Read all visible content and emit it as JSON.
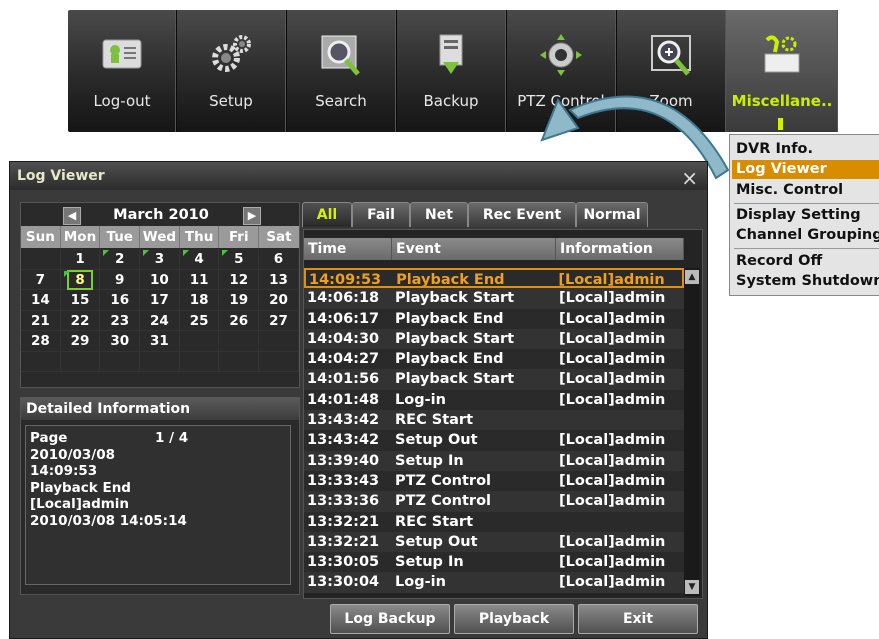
{
  "toolbar": {
    "items": [
      {
        "label": "Log-out",
        "icon": "logout-icon"
      },
      {
        "label": "Setup",
        "icon": "gears-icon"
      },
      {
        "label": "Search",
        "icon": "search-icon"
      },
      {
        "label": "Backup",
        "icon": "backup-icon"
      },
      {
        "label": "PTZ Control",
        "icon": "ptz-icon"
      },
      {
        "label": "Zoom",
        "icon": "zoom-icon"
      },
      {
        "label": "Miscellane..",
        "icon": "misc-icon"
      }
    ],
    "active_color": "#c8f000"
  },
  "menu": {
    "items": [
      "DVR Info.",
      "Log Viewer",
      "Misc. Control",
      "Display Setting",
      "Channel Grouping",
      "Record Off",
      "System Shutdown"
    ],
    "highlighted": "Log Viewer",
    "highlight_color": "#d88c00"
  },
  "window": {
    "title": "Log Viewer",
    "close": "×"
  },
  "calendar": {
    "month": "March 2010",
    "prev": "◀",
    "next": "▶",
    "days": [
      "Sun",
      "Mon",
      "Tue",
      "Wed",
      "Thu",
      "Fri",
      "Sat"
    ],
    "weeks": [
      [
        "",
        "1",
        "2",
        "3",
        "4",
        "5",
        "6"
      ],
      [
        "7",
        "8",
        "9",
        "10",
        "11",
        "12",
        "13"
      ],
      [
        "14",
        "15",
        "16",
        "17",
        "18",
        "19",
        "20"
      ],
      [
        "21",
        "22",
        "23",
        "24",
        "25",
        "26",
        "27"
      ],
      [
        "28",
        "29",
        "30",
        "31",
        "",
        "",
        ""
      ],
      [
        "",
        "",
        "",
        "",
        "",
        "",
        ""
      ]
    ],
    "selected": "8",
    "recorded_days": [
      "2",
      "3",
      "4",
      "5",
      "8"
    ]
  },
  "detail": {
    "title": "Detailed Information",
    "page_label": "Page",
    "page_value": "1 / 4",
    "date": "2010/03/08",
    "time": "14:09:53",
    "event": "Playback End",
    "user": "[Local]admin",
    "timestamp": "2010/03/08 14:05:14"
  },
  "tabs": [
    "All",
    "Fail",
    "Net",
    "Rec Event",
    "Normal"
  ],
  "active_tab": "All",
  "log": {
    "columns": [
      "Time",
      "Event",
      "Information"
    ],
    "rows": [
      [
        "14:09:53",
        "Playback End",
        "[Local]admin"
      ],
      [
        "14:06:18",
        "Playback Start",
        "[Local]admin"
      ],
      [
        "14:06:17",
        "Playback End",
        "[Local]admin"
      ],
      [
        "14:04:30",
        "Playback Start",
        "[Local]admin"
      ],
      [
        "14:04:27",
        "Playback End",
        "[Local]admin"
      ],
      [
        "14:01:56",
        "Playback Start",
        "[Local]admin"
      ],
      [
        "14:01:48",
        "Log-in",
        "[Local]admin"
      ],
      [
        "13:43:42",
        "REC Start",
        ""
      ],
      [
        "13:43:42",
        "Setup Out",
        "[Local]admin"
      ],
      [
        "13:39:40",
        "Setup In",
        "[Local]admin"
      ],
      [
        "13:33:43",
        "PTZ Control",
        "[Local]admin"
      ],
      [
        "13:33:36",
        "PTZ Control",
        "[Local]admin"
      ],
      [
        "13:32:21",
        "REC Start",
        ""
      ],
      [
        "13:32:21",
        "Setup Out",
        "[Local]admin"
      ],
      [
        "13:30:05",
        "Setup In",
        "[Local]admin"
      ],
      [
        "13:30:04",
        "Log-in",
        "[Local]admin"
      ]
    ],
    "selected_index": 0,
    "selected_color": "#f0a020"
  },
  "buttons": {
    "log_backup": "Log Backup",
    "playback": "Playback",
    "exit": "Exit"
  }
}
